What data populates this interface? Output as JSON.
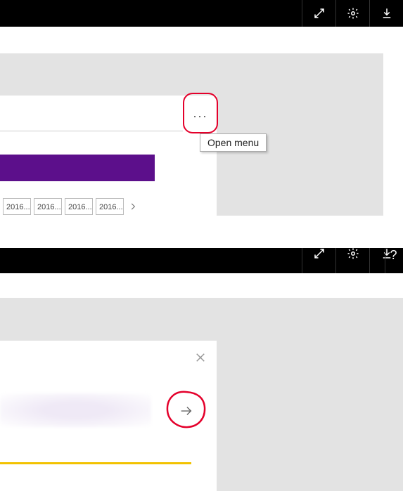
{
  "tooltip": {
    "open_menu": "Open menu"
  },
  "more_button": {
    "glyph": "..."
  },
  "chips": [
    "2016...",
    "2016...",
    "2016...",
    "2016..."
  ],
  "chart_data": {
    "type": "bar",
    "categories": [
      "(single visible bar)"
    ],
    "values": [
      100
    ],
    "title": "",
    "xlabel": "",
    "ylabel": "",
    "series_color": "#5c0f8b",
    "page_labels": [
      "2016...",
      "2016...",
      "2016...",
      "2016..."
    ]
  },
  "help": {
    "glyph": "?"
  },
  "colors": {
    "accent_purple": "#5c0f8b",
    "highlight_red": "#e4002b",
    "rule_yellow": "#f2c200"
  }
}
